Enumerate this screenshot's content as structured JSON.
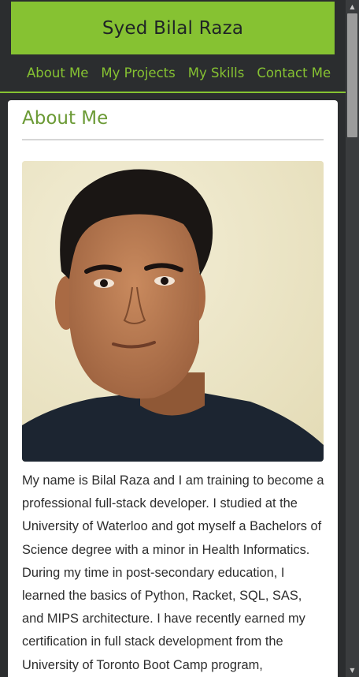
{
  "header": {
    "title": "Syed Bilal Raza"
  },
  "nav": {
    "items": [
      {
        "label": "About Me"
      },
      {
        "label": "My Projects"
      },
      {
        "label": "My Skills"
      },
      {
        "label": "Contact Me"
      }
    ]
  },
  "about": {
    "heading": "About Me",
    "bio": "My name is Bilal Raza and I am training to become a professional full-stack developer. I studied at the University of Waterloo and got myself a Bachelors of Science degree with a minor in Health Informatics. During my time in post-secondary education, I learned the basics of Python, Racket, SQL, SAS, and MIPS architecture. I have recently earned my certification in full stack development from the University of Toronto Boot Camp program,"
  },
  "colors": {
    "accent": "#86c232",
    "heading": "#6b9a35",
    "background": "#2b2d2f",
    "card": "#ffffff"
  },
  "icons": {
    "scroll_up": "triangle-up-icon",
    "scroll_down": "triangle-down-icon"
  }
}
